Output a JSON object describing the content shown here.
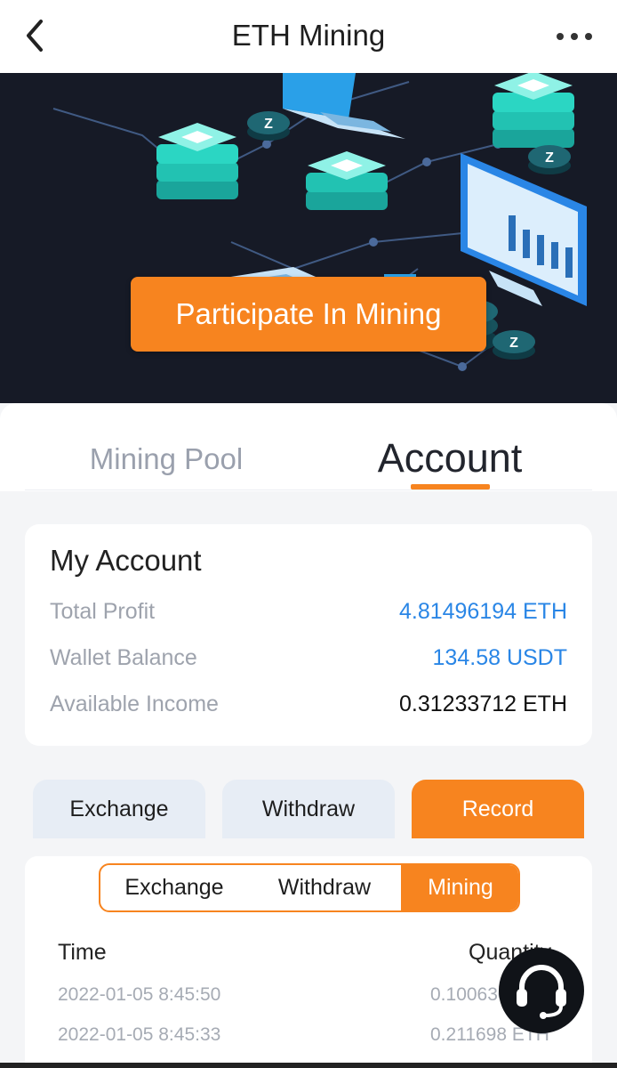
{
  "header": {
    "title": "ETH Mining",
    "back_icon": "chevron-left-icon",
    "more_icon": "more-dots-icon"
  },
  "banner": {
    "cta_label": "Participate In Mining",
    "coin_letter": "Z"
  },
  "tabs": [
    {
      "label": "Mining Pool",
      "active": false
    },
    {
      "label": "Account",
      "active": true
    }
  ],
  "account": {
    "title": "My Account",
    "rows": [
      {
        "label": "Total Profit",
        "value": "4.81496194 ETH"
      },
      {
        "label": "Wallet Balance",
        "value": "134.58 USDT"
      },
      {
        "label": "Available Income",
        "value": "0.31233712 ETH"
      }
    ]
  },
  "actions": [
    {
      "label": "Exchange"
    },
    {
      "label": "Withdraw"
    },
    {
      "label": "Record",
      "active": true
    }
  ],
  "record_tabs": [
    {
      "label": "Exchange"
    },
    {
      "label": "Withdraw"
    },
    {
      "label": "Mining",
      "active": true
    }
  ],
  "table": {
    "headers": {
      "time": "Time",
      "quantity": "Quantity"
    },
    "rows": [
      {
        "time": "2022-01-05 8:45:50",
        "quantity": "0.100630 ETH"
      },
      {
        "time": "2022-01-05 8:45:33",
        "quantity": "0.211698 ETH"
      }
    ]
  },
  "colors": {
    "accent": "#f7841f",
    "value_blue": "#2a86e6",
    "banner_bg": "#161a26"
  },
  "support_icon": "headset-icon"
}
